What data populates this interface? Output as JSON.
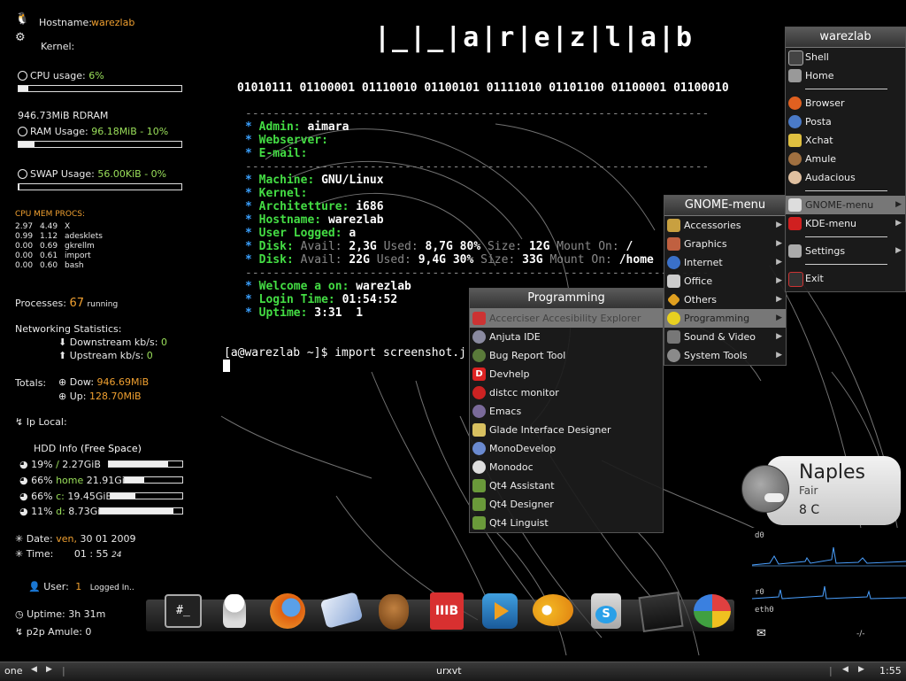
{
  "conky": {
    "hostname_label": "Hostname:",
    "hostname": "warezlab",
    "kernel_label": "Kernel:",
    "cpu_label": "CPU usage:",
    "cpu_value": "6%",
    "cpu_fraction": 0.06,
    "ram_total": "946.73MiB  RDRAM",
    "ram_label": "RAM Usage:",
    "ram_value": "96.18MiB - 10%",
    "ram_fraction": 0.1,
    "swap_label": "SWAP Usage:",
    "swap_value": "56.00KiB - 0%",
    "swap_fraction": 0.0,
    "proc_header": "CPU  MEM  PROCS:",
    "procs": [
      {
        "cpu": "2.97",
        "mem": "4.49",
        "name": "X"
      },
      {
        "cpu": "0.99",
        "mem": "1.12",
        "name": "adesklets"
      },
      {
        "cpu": "0.00",
        "mem": "0.69",
        "name": "gkrellm"
      },
      {
        "cpu": "0.00",
        "mem": "0.61",
        "name": "import"
      },
      {
        "cpu": "0.00",
        "mem": "0.60",
        "name": "bash"
      }
    ],
    "processes_label": "Processes:",
    "processes_value": "67",
    "processes_suffix": "running",
    "net_label": "Networking Statistics:",
    "down_label": "Downstream kb/s:",
    "down_value": "0",
    "up_label": "Upstream kb/s:",
    "up_value": "0",
    "totals_label": "Totals:",
    "dow_label": "Dow:",
    "dow_value": "946.69MiB",
    "up_total_label": "Up:",
    "up_total_value": "128.70MiB",
    "ip_label": "Ip Local:",
    "hdd_label": "HDD Info",
    "hdd_label2": "(Free Space)",
    "hdd": [
      {
        "pct": "19%",
        "name": "/",
        "size": "2.27GiB",
        "fraction": 0.81
      },
      {
        "pct": "66%",
        "name": "home",
        "size": "21.91GiB",
        "fraction": 0.34
      },
      {
        "pct": "66%",
        "name": "c:",
        "size": "19.45GiB",
        "fraction": 0.34
      },
      {
        "pct": "11%",
        "name": "d:",
        "size": "8.73GiB",
        "fraction": 0.89
      }
    ],
    "date_label": "Date:",
    "date_day": "ven,",
    "date_value": "30 01 2009",
    "time_label": "Time:",
    "time_value": "01 : 55",
    "time_sec": "24",
    "user_label": "User:",
    "user_value": "1",
    "user_suffix": "Logged In..",
    "uptime_label": "Uptime:",
    "uptime_value": "3h 31m",
    "p2p_label": "p2p Amule:",
    "p2p_value": "0"
  },
  "terminal": {
    "banner": "|_|_|a|r|e|z|l|a|b",
    "binary": "01010111 01100001 01110010 01100101 01111010 01101100 01100001 01100010",
    "dashes": "-------------------------------------------------------------------",
    "admin_key": "Admin:",
    "admin_val": "aimara",
    "webserver_key": "Webserver:",
    "email_key": "E-mail:",
    "machine_key": "Machine:",
    "machine_val": "GNU/Linux",
    "kernel_key": "Kernel:",
    "arch_key": "Architetture:",
    "arch_val": "i686",
    "hostname_key": "Hostname:",
    "hostname_val": "warezlab",
    "user_key": "User Logged:",
    "user_val": "a",
    "disk_key": "Disk:",
    "disk1": {
      "avail_l": "Avail:",
      "avail": "2,3G",
      "used_l": "Used:",
      "used": "8,7G 80%",
      "size_l": "Size:",
      "size": "12G",
      "mount_l": "Mount On:",
      "mount": "/"
    },
    "disk2": {
      "avail_l": "Avail:",
      "avail": "22G",
      "used_l": "Used:",
      "used": "9,4G 30%",
      "size_l": "Size:",
      "size": "33G",
      "mount_l": "Mount On:",
      "mount": "/home"
    },
    "welcome_key": "Welcome a on:",
    "welcome_val": "warezlab",
    "login_key": "Login Time:",
    "login_val": "01:54:52",
    "uptime_key": "Uptime:",
    "uptime_val": "3:31  1",
    "prompt": "[a@warezlab ~]$ import screenshot.j"
  },
  "main_menu": {
    "title": "warezlab",
    "items": [
      {
        "label": "Shell"
      },
      {
        "label": "Home"
      },
      {
        "label": "Browser"
      },
      {
        "label": "Posta"
      },
      {
        "label": "Xchat"
      },
      {
        "label": "Amule"
      },
      {
        "label": "Audacious"
      },
      {
        "label": "GNOME-menu"
      },
      {
        "label": "KDE-menu"
      },
      {
        "label": "Settings"
      },
      {
        "label": "Exit"
      }
    ]
  },
  "gnome_menu": {
    "title": "GNOME-menu",
    "items": [
      {
        "label": "Accessories"
      },
      {
        "label": "Graphics"
      },
      {
        "label": "Internet"
      },
      {
        "label": "Office"
      },
      {
        "label": "Others"
      },
      {
        "label": "Programming"
      },
      {
        "label": "Sound & Video"
      },
      {
        "label": "System Tools"
      }
    ]
  },
  "programming_menu": {
    "title": "Programming",
    "items": [
      {
        "label": "Accerciser Accesibility Explorer"
      },
      {
        "label": "Anjuta IDE"
      },
      {
        "label": "Bug Report Tool"
      },
      {
        "label": "Devhelp"
      },
      {
        "label": "distcc monitor"
      },
      {
        "label": "Emacs"
      },
      {
        "label": "Glade Interface Designer"
      },
      {
        "label": "MonoDevelop"
      },
      {
        "label": "Monodoc"
      },
      {
        "label": "Qt4 Assistant"
      },
      {
        "label": "Qt4 Designer"
      },
      {
        "label": "Qt4 Linguist"
      }
    ]
  },
  "dock": {
    "items": [
      {
        "icon": "terminal-icon",
        "glyph": "#_"
      },
      {
        "icon": "robot-icon"
      },
      {
        "icon": "firefox-icon"
      },
      {
        "icon": "mail-icon"
      },
      {
        "icon": "amule-icon"
      },
      {
        "icon": "gmb-icon"
      },
      {
        "icon": "media-player-icon"
      },
      {
        "icon": "messenger-icon"
      },
      {
        "icon": "skype-icon"
      },
      {
        "icon": "movie-icon"
      },
      {
        "icon": "msn-icon"
      }
    ]
  },
  "weather": {
    "city": "Naples",
    "condition": "Fair",
    "temp": "8 C"
  },
  "gkrellm": {
    "disk_label": "d0",
    "disk_label2": "r0",
    "net_label": "eth0",
    "mail_glyph": "✉",
    "right_glyph": "-/-"
  },
  "bottombar": {
    "workspace": "one",
    "task": "urxvt",
    "clock": "1:55"
  },
  "colors": {
    "accent_orange": "#f0a030",
    "term_green": "#44dd44",
    "term_blue": "#3aa0ff"
  }
}
